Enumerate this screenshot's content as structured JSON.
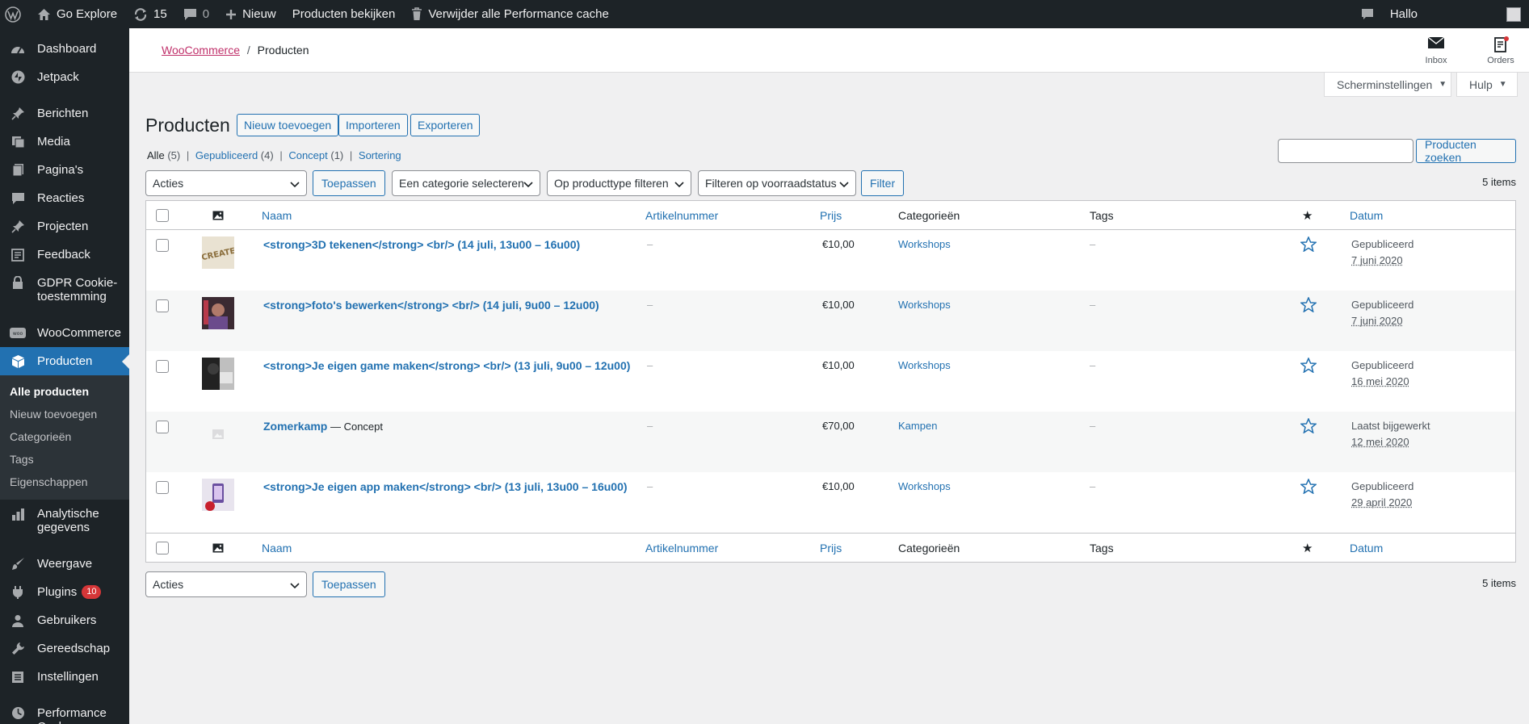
{
  "adminbar": {
    "site_name": "Go Explore",
    "updates_count": "15",
    "comments_count": "0",
    "new_label": "Nieuw",
    "view_products": "Producten bekijken",
    "purge_cache": "Verwijder alle Performance cache",
    "greeting": "Hallo"
  },
  "sidebar": {
    "items": [
      {
        "label": "Dashboard",
        "icon": "dashboard-icon"
      },
      {
        "label": "Jetpack",
        "icon": "jetpack-icon"
      },
      {
        "label": "Berichten",
        "icon": "pin-icon"
      },
      {
        "label": "Media",
        "icon": "media-icon"
      },
      {
        "label": "Pagina's",
        "icon": "page-icon"
      },
      {
        "label": "Reacties",
        "icon": "comment-icon"
      },
      {
        "label": "Projecten",
        "icon": "pin-icon"
      },
      {
        "label": "Feedback",
        "icon": "feedback-icon"
      },
      {
        "label": "GDPR Cookie-toestemming",
        "icon": "lock-icon"
      },
      {
        "label": "WooCommerce",
        "icon": "woo-icon"
      },
      {
        "label": "Producten",
        "icon": "product-box-icon"
      },
      {
        "label": "Analytische gegevens",
        "icon": "chart-icon"
      },
      {
        "label": "Weergave",
        "icon": "brush-icon"
      },
      {
        "label": "Plugins",
        "icon": "plugin-icon",
        "badge": "10"
      },
      {
        "label": "Gebruikers",
        "icon": "users-icon"
      },
      {
        "label": "Gereedschap",
        "icon": "wrench-icon"
      },
      {
        "label": "Instellingen",
        "icon": "settings-icon"
      },
      {
        "label": "Performance Cache",
        "icon": "cache-icon"
      }
    ],
    "submenu": [
      "Alle producten",
      "Nieuw toevoegen",
      "Categorieën",
      "Tags",
      "Eigenschappen"
    ]
  },
  "header": {
    "breadcrumb_link": "WooCommerce",
    "breadcrumb_sep": "/",
    "breadcrumb_current": "Producten",
    "inbox_label": "Inbox",
    "orders_label": "Orders"
  },
  "screen_options": "Scherminstellingen",
  "help": "Hulp",
  "page": {
    "title": "Producten",
    "actions": [
      "Nieuw toevoegen",
      "Importeren",
      "Exporteren"
    ]
  },
  "views": {
    "all": "Alle",
    "all_count": "(5)",
    "published": "Gepubliceerd",
    "published_count": "(4)",
    "draft": "Concept",
    "draft_count": "(1)",
    "sorting": "Sortering"
  },
  "search": {
    "button": "Producten zoeken",
    "placeholder": ""
  },
  "filters": {
    "bulk_action": "Acties",
    "apply": "Toepassen",
    "category": "Een categorie selecteren",
    "product_type": "Op producttype filteren",
    "stock": "Filteren op voorraadstatus",
    "filter_button": "Filter",
    "items_count": "5 items"
  },
  "table": {
    "columns": {
      "name": "Naam",
      "sku": "Artikelnummer",
      "price": "Prijs",
      "categories": "Categorieën",
      "tags": "Tags",
      "date": "Datum"
    },
    "rows": [
      {
        "name": "<strong>3D tekenen</strong> <br/> (14 juli, 13u00 – 16u00)",
        "suffix": "",
        "sku": "–",
        "price": "€10,00",
        "category": "Workshops",
        "tags": "–",
        "status": "Gepubliceerd",
        "date": "7 juni 2020",
        "thumb_color": "#d8c9a8"
      },
      {
        "name": "<strong>foto's bewerken</strong> <br/> (14 juli, 9u00 – 12u00)",
        "suffix": "",
        "sku": "–",
        "price": "€10,00",
        "category": "Workshops",
        "tags": "–",
        "status": "Gepubliceerd",
        "date": "7 juni 2020",
        "thumb_color": "#5a3b3e"
      },
      {
        "name": "<strong>Je eigen game maken</strong> <br/> (13 juli, 9u00 – 12u00)",
        "suffix": "",
        "sku": "–",
        "price": "€10,00",
        "category": "Workshops",
        "tags": "–",
        "status": "Gepubliceerd",
        "date": "16 mei 2020",
        "thumb_color": "#3a3a3a"
      },
      {
        "name": "Zomerkamp",
        "suffix": " — Concept",
        "sku": "–",
        "price": "€70,00",
        "category": "Kampen",
        "tags": "–",
        "status": "Laatst bijgewerkt",
        "date": "12 mei 2020",
        "thumb_color": ""
      },
      {
        "name": "<strong>Je eigen app maken</strong> <br/> (13 juli, 13u00 – 16u00)",
        "suffix": "",
        "sku": "–",
        "price": "€10,00",
        "category": "Workshops",
        "tags": "–",
        "status": "Gepubliceerd",
        "date": "29 april 2020",
        "thumb_color": "#c9c3d6"
      }
    ]
  }
}
